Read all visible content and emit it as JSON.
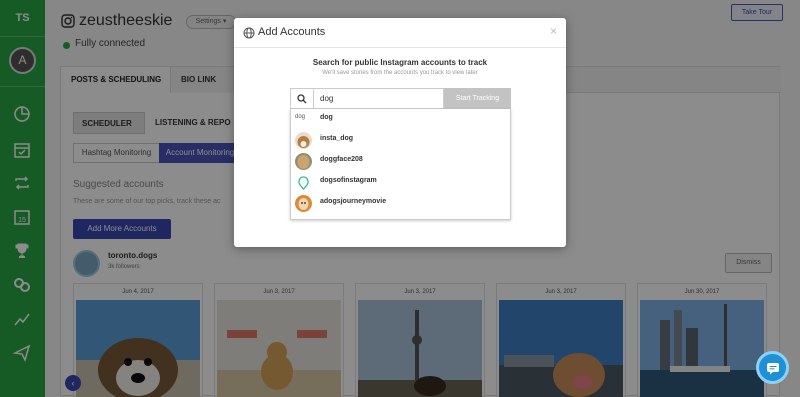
{
  "sidebar": {
    "initials": "TS",
    "avatar_letter": "A",
    "icons": [
      "analytics-icon",
      "calendar-icon",
      "repeat-icon",
      "calendar-day-icon",
      "trophy-icon",
      "link-icon",
      "trend-icon",
      "send-icon"
    ]
  },
  "profile": {
    "username": "zeustheeskie",
    "settings_label": "Settings ▾",
    "status": "Fully connected"
  },
  "header": {
    "take_tour": "Take Tour"
  },
  "tabs": {
    "posts": "POSTS & SCHEDULING",
    "bio": "BIO LINK"
  },
  "subtabs": {
    "scheduler": "SCHEDULER",
    "listening": "LISTENING & REPO"
  },
  "monitoring": {
    "hashtag": "Hashtag Monitoring",
    "account": "Account Monitoring"
  },
  "suggested": {
    "title": "Suggested accounts",
    "description": "These are some of our top picks, track these ac",
    "add_more": "Add More Accounts",
    "account_name": "toronto.dogs",
    "account_followers": "3k followers",
    "dismiss": "Dismiss"
  },
  "photos": [
    {
      "date": "Jun 4, 2017"
    },
    {
      "date": "Jun 3, 2017"
    },
    {
      "date": "Jun 3, 2017"
    },
    {
      "date": "Jun 3, 2017"
    },
    {
      "date": "Jun 30, 2017"
    }
  ],
  "modal": {
    "title": "Add Accounts",
    "close": "×",
    "heading": "Search for public Instagram accounts to track",
    "subheading": "We'll save stories from the accounts you track to view later",
    "search_value": "dog",
    "track_button": "Start Tracking",
    "results": [
      {
        "label": "dog",
        "avatar_text": "dog"
      },
      {
        "label": "insta_dog"
      },
      {
        "label": "doggface208"
      },
      {
        "label": "dogsofinstagram"
      },
      {
        "label": "adogsjourneymovie"
      }
    ]
  },
  "colors": {
    "sidebar_green": "#28a745",
    "primary_blue": "#3a47b0",
    "chat_blue": "#1e90d8"
  }
}
